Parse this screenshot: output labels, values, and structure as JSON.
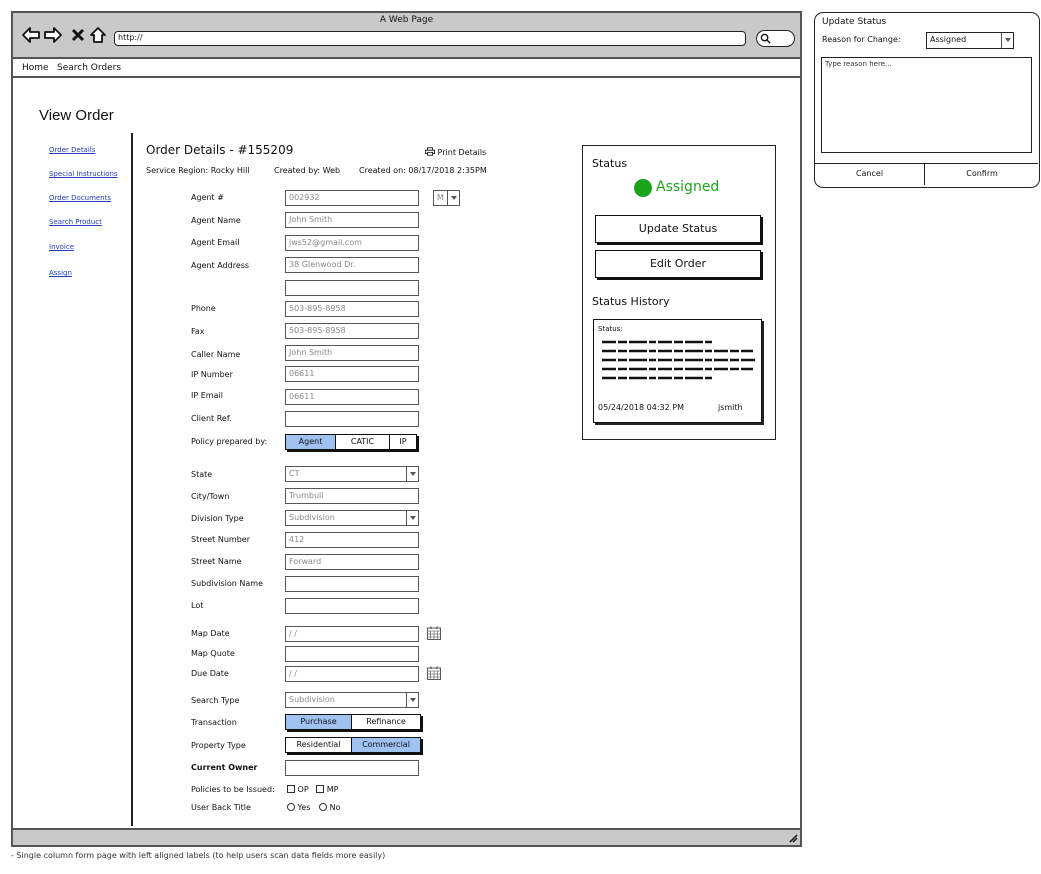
{
  "window": {
    "title": "A Web Page",
    "url": "http://"
  },
  "menu": {
    "items": [
      "Home",
      "Search Orders"
    ]
  },
  "page": {
    "title": "View Order"
  },
  "sidebar": {
    "links": [
      "Order Details",
      "Special Instructions",
      "Order Documents",
      "Search Product",
      "Invoice",
      "Assign"
    ]
  },
  "order": {
    "heading": "Order Details - #155209",
    "print_label": "Print Details",
    "service_region": "Service Region: Rocky Hill",
    "created_by": "Created by: Web",
    "created_on": "Created on: 08/17/2018 2:35PM"
  },
  "form": {
    "agent_no": {
      "label": "Agent #",
      "value": "002932",
      "suffix": "M"
    },
    "agent_name": {
      "label": "Agent Name",
      "value": "John Smith"
    },
    "agent_email": {
      "label": "Agent Email",
      "value": "jws52@gmail.com"
    },
    "agent_address": {
      "label": "Agent Address",
      "value": "38 Glenwood Dr.",
      "value2": ""
    },
    "phone": {
      "label": "Phone",
      "value": "503-895-8958"
    },
    "fax": {
      "label": "Fax",
      "value": "503-895-8958"
    },
    "caller_name": {
      "label": "Caller Name",
      "value": "John Smith"
    },
    "ip_number": {
      "label": "IP Number",
      "value": "06611"
    },
    "ip_email": {
      "label": "IP Email",
      "value": "06611"
    },
    "client_ref": {
      "label": "Client Ref.",
      "value": ""
    },
    "policy_prepared_by": {
      "label": "Policy prepared by:",
      "options": [
        "Agent",
        "CATIC",
        "IP"
      ],
      "selected": "Agent"
    },
    "state": {
      "label": "State",
      "value": "CT"
    },
    "city": {
      "label": "City/Town",
      "value": "Trumbull"
    },
    "division_type": {
      "label": "Division Type",
      "value": "Subdivision"
    },
    "street_number": {
      "label": "Street Number",
      "value": "412"
    },
    "street_name": {
      "label": "Street Name",
      "value": "Forward"
    },
    "subdivision_name": {
      "label": "Subdivision Name",
      "value": ""
    },
    "lot": {
      "label": "Lot",
      "value": ""
    },
    "map_date": {
      "label": "Map Date",
      "value": " / /"
    },
    "map_quote": {
      "label": "Map Quote",
      "value": ""
    },
    "due_date": {
      "label": "Due Date",
      "value": " / /"
    },
    "search_type": {
      "label": "Search Type",
      "value": "Subdivision"
    },
    "transaction": {
      "label": "Transaction",
      "options": [
        "Purchase",
        "Refinance"
      ],
      "selected": "Purchase"
    },
    "property_type": {
      "label": "Property Type",
      "options": [
        "Residential",
        "Commercial"
      ],
      "selected": "Commercial"
    },
    "current_owner": {
      "label": "Current Owner",
      "value": ""
    },
    "policies": {
      "label": "Policies to be Issued:",
      "options": [
        "OP",
        "MP"
      ]
    },
    "user_back_title": {
      "label": "User Back Title",
      "options": [
        "Yes",
        "No"
      ]
    }
  },
  "status_panel": {
    "title": "Status",
    "current": "Assigned",
    "current_color": "#1aa51a",
    "update_button": "Update Status",
    "edit_button": "Edit Order",
    "history_title": "Status History",
    "history_label": "Status:",
    "history_date": "05/24/2018 04:32 PM",
    "history_user": "jsmith"
  },
  "dialog": {
    "title": "Update Status",
    "reason_label": "Reason for Change:",
    "reason_value": "Assigned",
    "textarea_placeholder": "Type reason here...",
    "cancel": "Cancel",
    "confirm": "Confirm"
  },
  "footnote": "- Single column form page with left aligned labels (to help users scan data fields more easily)"
}
